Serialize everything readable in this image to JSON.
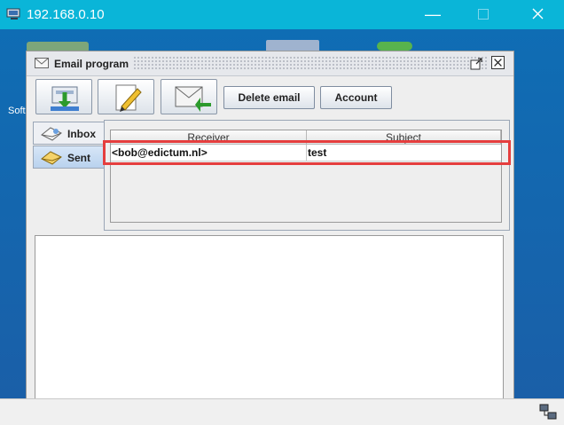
{
  "window": {
    "title": "192.168.0.10"
  },
  "desktop": {
    "fragment_text": "Soft"
  },
  "email_window": {
    "title": "Email program"
  },
  "toolbar": {
    "icon_buttons": [
      {
        "icon": "download-mail-icon"
      },
      {
        "icon": "compose-pencil-icon"
      },
      {
        "icon": "reply-envelope-icon"
      }
    ],
    "delete_label": "Delete email",
    "account_label": "Account"
  },
  "tabs": [
    {
      "label": "Inbox",
      "icon": "inbox-icon"
    },
    {
      "label": "Sent",
      "icon": "sent-icon"
    }
  ],
  "table": {
    "columns": [
      "Receiver",
      "Subject"
    ],
    "rows": [
      {
        "receiver": "<bob@edictum.nl>",
        "subject": "test"
      }
    ]
  },
  "colors": {
    "highlight": "#e53e3e",
    "titlebar": "#0ab5d8"
  }
}
